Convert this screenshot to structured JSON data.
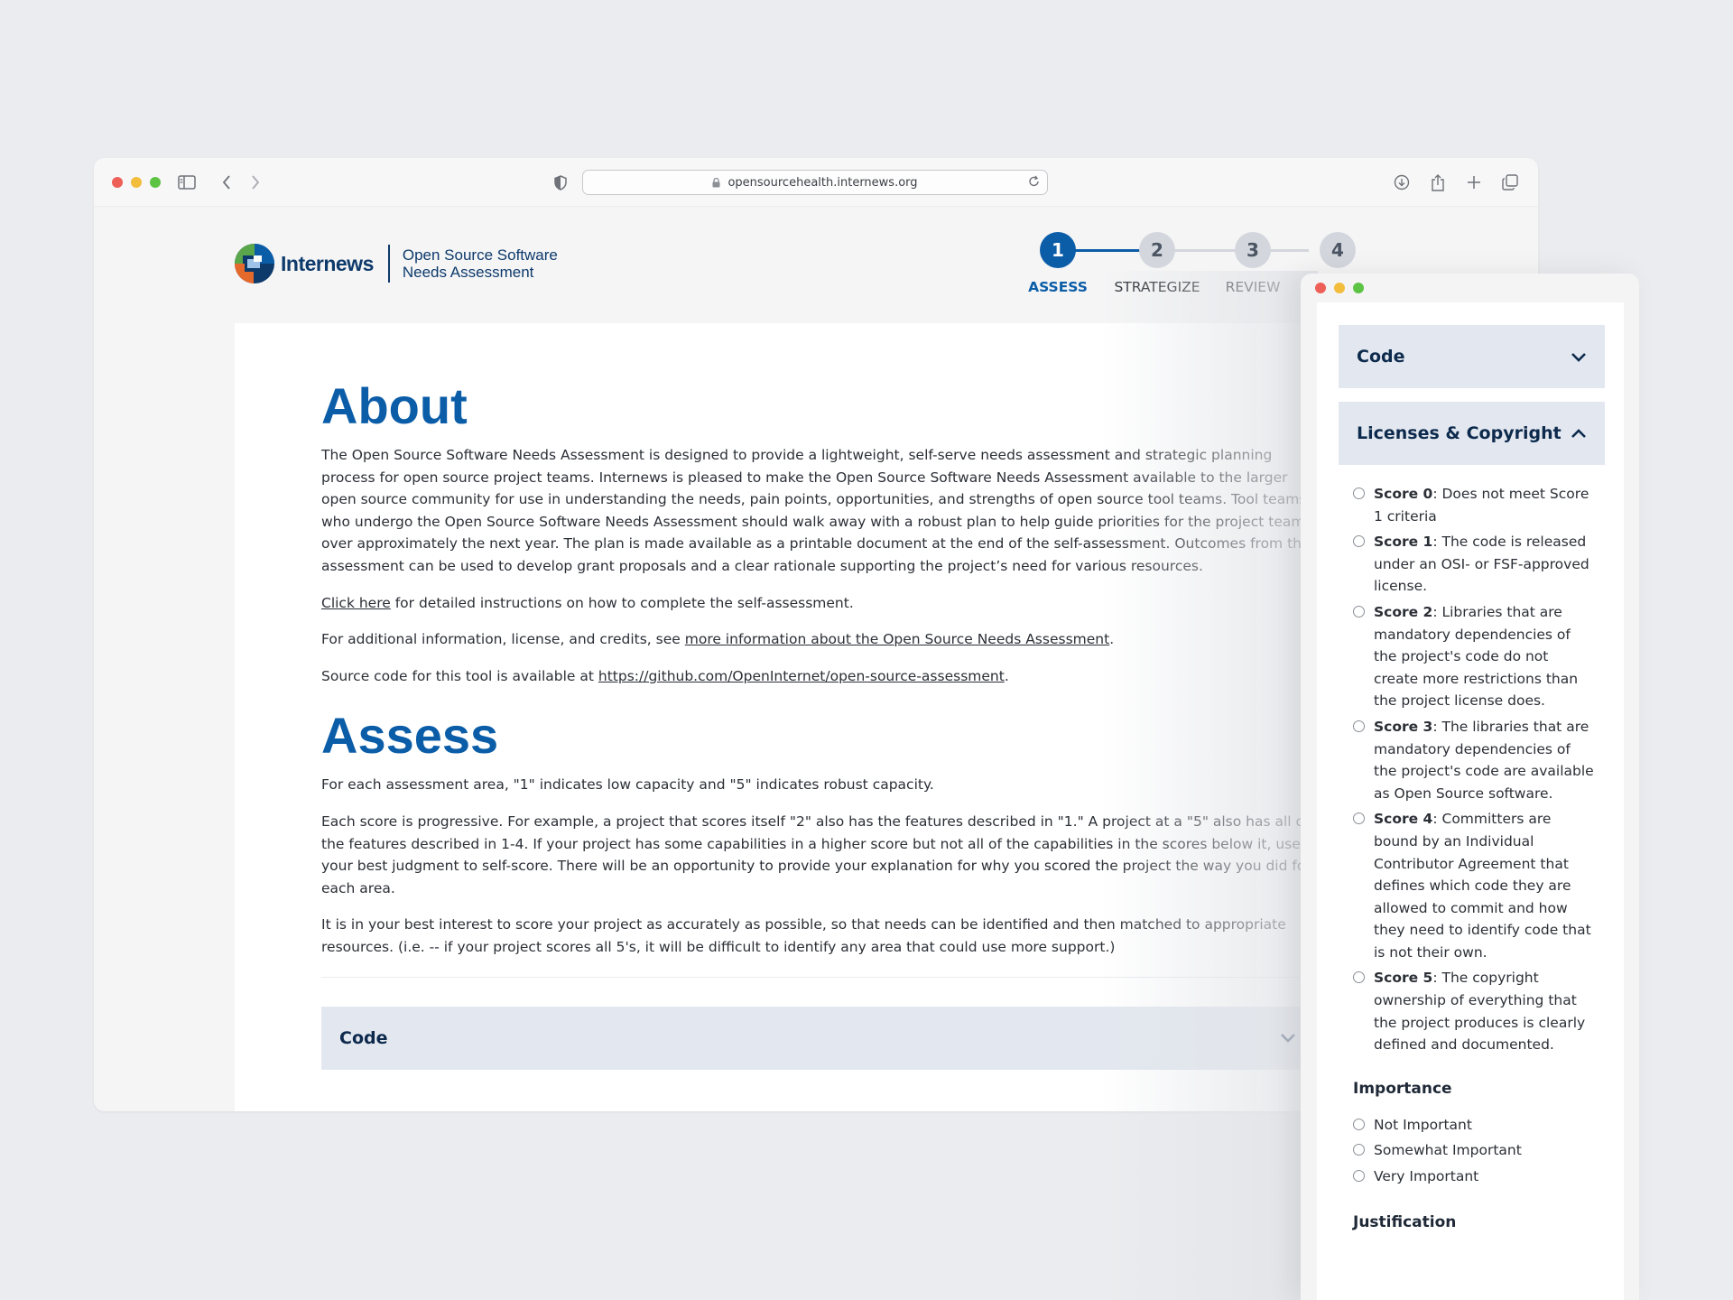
{
  "browser": {
    "url": "opensourcehealth.internews.org"
  },
  "site": {
    "logo_name": "Internews",
    "subtitle_line1": "Open Source Software",
    "subtitle_line2": "Needs Assessment"
  },
  "stepper": {
    "steps": [
      {
        "number": "1",
        "label": "ASSESS"
      },
      {
        "number": "2",
        "label": "STRATEGIZE"
      },
      {
        "number": "3",
        "label": "REVIEW"
      },
      {
        "number": "4",
        "label": ""
      }
    ],
    "active_step": 1
  },
  "about": {
    "title": "About",
    "paragraph": "The Open Source Software Needs Assessment is designed to provide a lightweight, self-serve needs assessment and strategic planning process for open source project teams. Internews is pleased to make the Open Source Software Needs Assessment available to the larger open source community for use in understanding the needs, pain points, opportunities, and strengths of open source tool teams. Tool teams who undergo the Open Source Software Needs Assessment should walk away with a robust plan to help guide priorities for the project team over approximately the next year. The plan is made available as a printable document at the end of the self-assessment. Outcomes from the assessment can be used to develop grant proposals and a clear rationale supporting the project’s need for various resources.",
    "click_here_link": "Click here",
    "click_here_rest": " for detailed instructions on how to complete the self-assessment.",
    "more_info_prefix": "For additional information, license, and credits, see ",
    "more_info_link": "more information about the Open Source Needs Assessment",
    "more_info_suffix": ".",
    "source_prefix": "Source code for this tool is available at ",
    "source_link": "https://github.com/OpenInternet/open-source-assessment",
    "source_suffix": "."
  },
  "assess": {
    "title": "Assess",
    "p1": "For each assessment area, \"1\" indicates low capacity and \"5\" indicates robust capacity.",
    "p2": "Each score is progressive. For example, a project that scores itself \"2\" also has the features described in \"1.\" A project at a \"5\" also has all of the features described in 1-4. If your project has some capabilities in a higher score but not all of the capabilities in the scores below it, use your best judgment to self-score. There will be an opportunity to provide your explanation for why you scored the project the way you did for each area.",
    "p3": "It is in your best interest to score your project as accurately as possible, so that needs can be identified and then matched to appropriate resources. (i.e. -- if your project scores all 5's, it will be difficult to identify any area that could use more support.)",
    "accordion_label": "Code"
  },
  "panel": {
    "code_label": "Code",
    "licenses_label": "Licenses & Copyright",
    "scores": [
      {
        "label": "Score 0",
        "text": ": Does not meet Score 1 criteria"
      },
      {
        "label": "Score 1",
        "text": ": The code is released under an OSI- or FSF-approved license."
      },
      {
        "label": "Score 2",
        "text": ": Libraries that are mandatory dependencies of the project's code do not create more restrictions than the project license does."
      },
      {
        "label": "Score 3",
        "text": ": The libraries that are mandatory dependencies of the project's code are available as Open Source software."
      },
      {
        "label": "Score 4",
        "text": ": Committers are bound by an Individual Contributor Agreement that defines which code they are allowed to commit and how they need to identify code that is not their own."
      },
      {
        "label": "Score 5",
        "text": ": The copyright ownership of everything that the project produces is clearly defined and documented."
      }
    ],
    "importance_heading": "Importance",
    "importance_options": [
      "Not Important",
      "Somewhat Important",
      "Very Important"
    ],
    "justification_heading": "Justification"
  },
  "colors": {
    "brand_blue": "#0b5da8",
    "navy": "#0d2a4d",
    "accordion_bg": "#e3e8f0"
  }
}
